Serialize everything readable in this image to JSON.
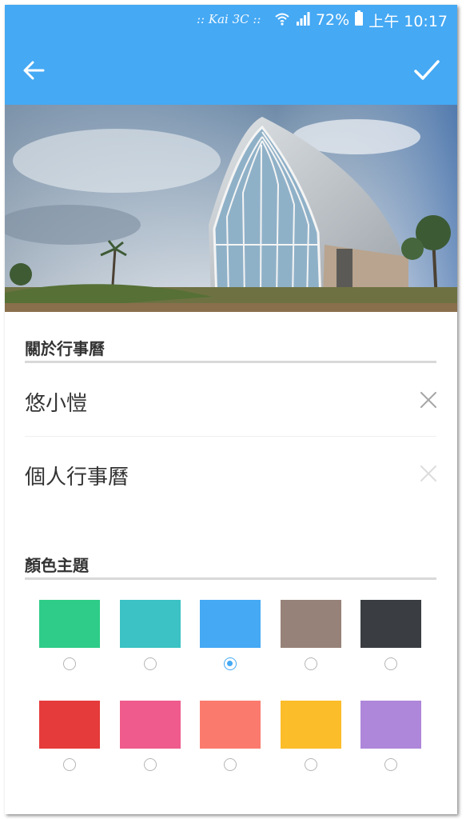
{
  "status_bar": {
    "watermark": ":: Kai 3C ::",
    "battery": "72%",
    "time": "上午 10:17",
    "icons": [
      "wifi-icon",
      "signal-icon",
      "battery-icon"
    ]
  },
  "toolbar": {
    "back_icon": "arrow-left-icon",
    "confirm_icon": "check-icon",
    "background": "#45a9f4"
  },
  "header_image": {
    "alt": ""
  },
  "about_section": {
    "title": "關於行事曆",
    "name_value": "悠小愷",
    "description_value": "個人行事曆"
  },
  "theme_section": {
    "title": "顏色主題",
    "selected_index": 2,
    "colors": [
      "#2ecc88",
      "#3cc2c4",
      "#45a9f4",
      "#978279",
      "#3a3d42",
      "#e53b3b",
      "#ef5b8c",
      "#fa7b6e",
      "#fbbd2a",
      "#ae87da"
    ]
  }
}
